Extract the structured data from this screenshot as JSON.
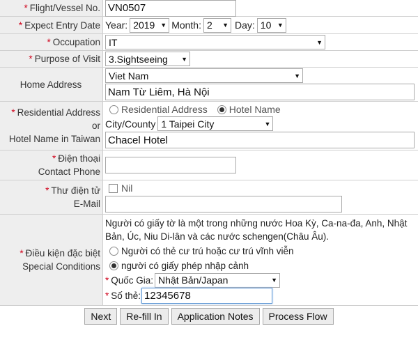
{
  "required_mark": "*",
  "flight": {
    "label": "Flight/Vessel No.",
    "value": "VN0507"
  },
  "entry_date": {
    "label": "Expect Entry Date",
    "year_label": "Year:",
    "year": "2019",
    "month_label": "Month:",
    "month": "2",
    "day_label": "Day:",
    "day": "10"
  },
  "occupation": {
    "label": "Occupation",
    "value": "IT"
  },
  "purpose": {
    "label": "Purpose of Visit",
    "value": "3.Sightseeing"
  },
  "home_address": {
    "label": "Home Address",
    "country": "Viet Nam",
    "value": "Nam Từ Liêm, Hà Nội"
  },
  "residential": {
    "label_1": "Residential Address or",
    "label_2": "Hotel Name in Taiwan",
    "option_residential": "Residential Address",
    "option_hotel": "Hotel Name",
    "city_label": "City/County",
    "city": "1 Taipei City",
    "hotel": "Chacel Hotel"
  },
  "phone": {
    "label_1": "Điện thoại",
    "label_2": "Contact Phone",
    "value": ""
  },
  "email": {
    "label_1": "Thư điện tử",
    "label_2": "E-Mail",
    "nil_label": "Nil",
    "value": ""
  },
  "special": {
    "label_1": "Điều kiện đặc biệt",
    "label_2": "Special Conditions",
    "desc_1": "Người có giấy tờ là một trong những nước Hoa Kỳ, Ca-na-đa, Anh, Nhật",
    "desc_2": "Bản, Úc, Niu Di-lân và các nước schengen(Châu Âu).",
    "option_1": "Người có thẻ cư trú hoặc cư trú vĩnh viễn",
    "option_2": "người có giấy phép nhập cảnh",
    "country_label": "Quốc Gia:",
    "country": "Nhật Bản/Japan",
    "card_label": "Số thẻ:",
    "card_value": "12345678"
  },
  "buttons": {
    "next": "Next",
    "refill": "Re-fill In",
    "notes": "Application Notes",
    "flow": "Process Flow"
  }
}
